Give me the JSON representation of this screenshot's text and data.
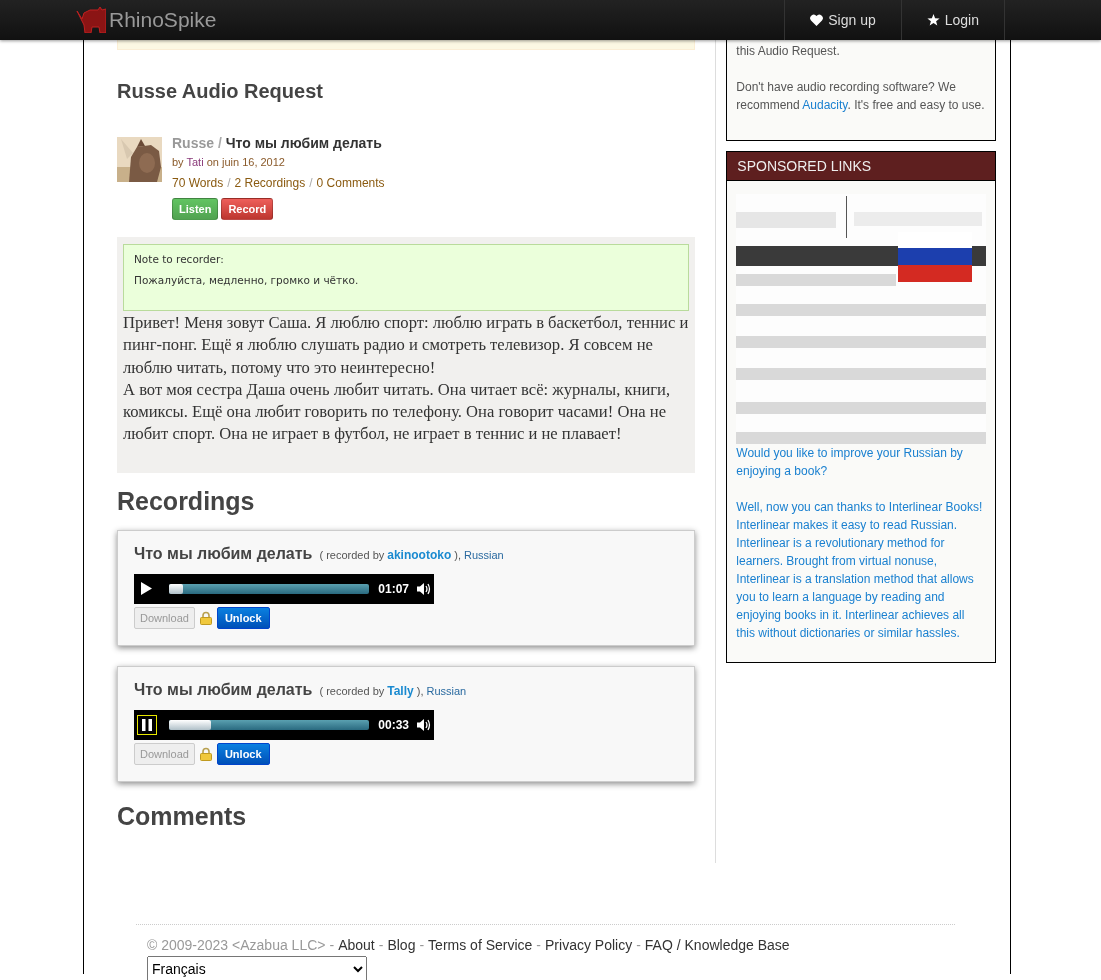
{
  "nav": {
    "logo_text": "RhinoSpike",
    "links": [
      {
        "label": "Sign up",
        "kind": "heart"
      },
      {
        "label": "Login",
        "kind": "star"
      }
    ]
  },
  "request": {
    "title": "Russe Audio Request",
    "language": "Russe",
    "separator": "/",
    "name": "Что мы любим делать",
    "by": "by",
    "author": "Tati",
    "date": "on juin 16, 2012",
    "stats": [
      "70 Words",
      "2 Recordings",
      "0 Comments"
    ],
    "buttons": [
      {
        "label": "Listen",
        "kind": "listen"
      },
      {
        "label": "Record",
        "kind": "record"
      }
    ],
    "note": {
      "label": "Note to recorder:",
      "text": "Пожалуйста, медленно, громко и чётко."
    },
    "paragraphs": [
      "Привет! Меня зовут Саша. Я люблю спорт: люблю играть в баскетбол, теннис и пинг-понг. Ещё я люблю слушать радио и смотреть телевизор. Я совсем не люблю читать, потому что это неинтересно!",
      "А вот моя сестра Даша очень любит читать. Она читает всё: журналы, книги, комиксы. Ещё она любит говорить по телефону. Она говорит часами! Она не любит спорт. Она не играет в футбол, не играет в теннис и не плавает!"
    ]
  },
  "recordings": {
    "heading": "Recordings",
    "items": [
      {
        "title": "Что мы любим делать",
        "prefix": "( recorded by",
        "recorder": "akinootoko",
        "suffix": "),",
        "language": "Russian",
        "player": {
          "playing": false,
          "level": 0.07,
          "time": "01:07"
        },
        "download": "Download",
        "unlock": "Unlock"
      },
      {
        "title": "Что мы любим делать",
        "prefix": "( recorded by",
        "recorder": "Tally",
        "suffix": "),",
        "language": "Russian",
        "player": {
          "playing": true,
          "level": 0.21,
          "time": "00:33"
        },
        "download": "Download",
        "unlock": "Unlock"
      }
    ]
  },
  "comments": {
    "heading": "Comments"
  },
  "sidebar": {
    "help": {
      "cut_line": "this Audio Request.",
      "before": "Don't have audio recording software? We recommend",
      "link": "Audacity",
      "after": ". It's free and easy to use."
    },
    "sponsored": {
      "title": "SPONSORED LINKS",
      "ad": {
        "kind": "picture"
      },
      "paragraphs": [
        "Would you like to improve your Russian by enjoying a book?",
        "Well, now you can thanks to Interlinear Books! Interlinear makes it easy to read Russian. Interlinear is a revolutionary method for learners. Brought from virtual nonuse, Interlinear is a translation method that allows you to learn a language by reading and enjoying books in it. Interlinear achieves all this without dictionaries or similar hassles."
      ]
    }
  },
  "footer": {
    "copyright": "© 2009-2023 <Azabua LLC>",
    "separator": "-",
    "links": [
      "About",
      "Blog",
      "Terms of Service",
      "Privacy Policy",
      "FAQ / Knowledge Base"
    ],
    "language": "Français"
  }
}
